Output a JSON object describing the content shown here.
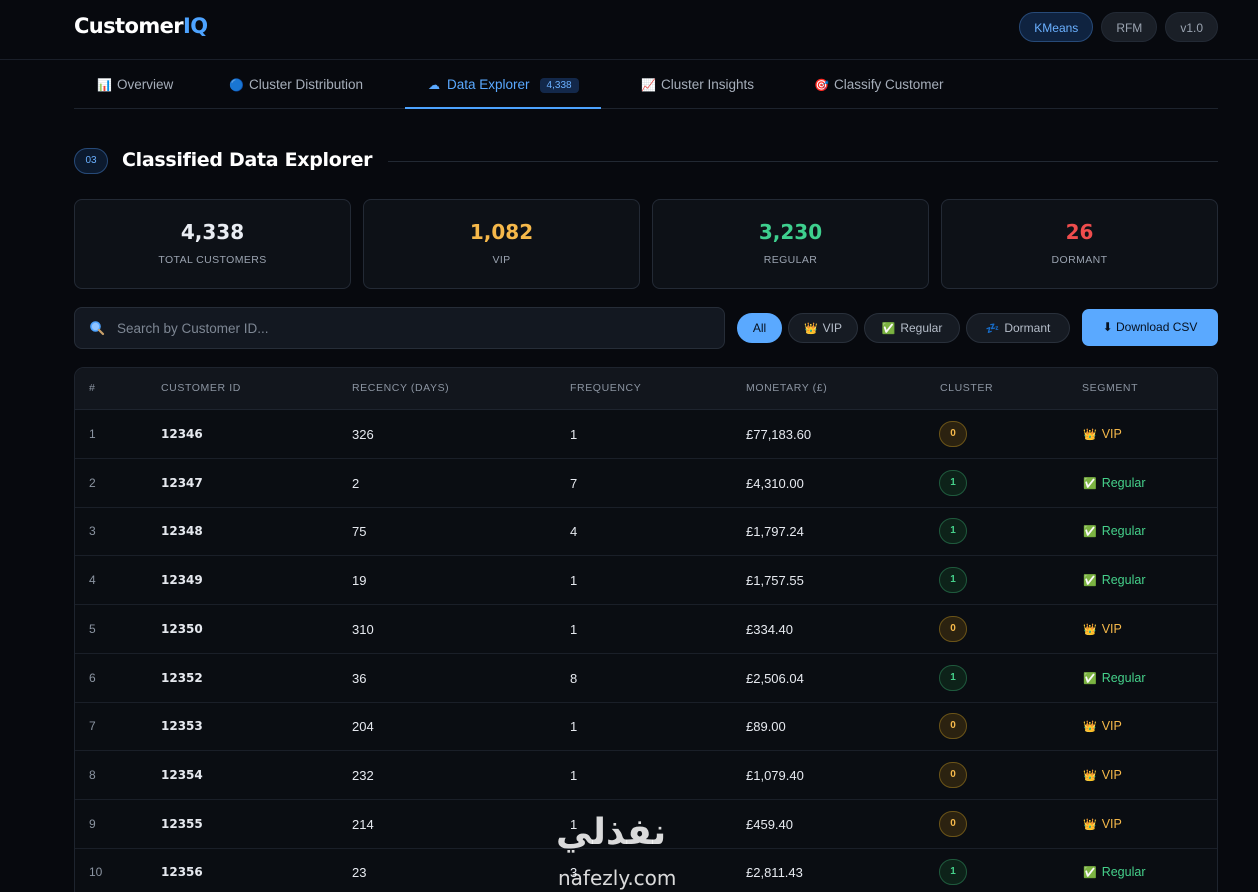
{
  "app": {
    "logo_main": "Customer",
    "logo_accent": "IQ"
  },
  "header_pills": [
    "KMeans",
    "RFM",
    "v1.0"
  ],
  "tabs": [
    {
      "icon": "📊",
      "label": "Overview"
    },
    {
      "icon": "🔵",
      "label": "Cluster Distribution"
    },
    {
      "icon": "☁",
      "label": "Data Explorer",
      "badge": "4,338"
    },
    {
      "icon": "📈",
      "label": "Cluster Insights"
    },
    {
      "icon": "🎯",
      "label": "Classify Customer"
    }
  ],
  "section": {
    "number": "03",
    "title": "Classified Data Explorer"
  },
  "stats": [
    {
      "value": "4,338",
      "label": "TOTAL CUSTOMERS",
      "color": "#e9edf3"
    },
    {
      "value": "1,082",
      "label": "VIP",
      "color": "#f5b84a"
    },
    {
      "value": "3,230",
      "label": "REGULAR",
      "color": "#3ecf8e"
    },
    {
      "value": "26",
      "label": "DORMANT",
      "color": "#ef4d4d"
    }
  ],
  "search": {
    "placeholder": "Search by Customer ID...",
    "value": ""
  },
  "filters": [
    {
      "icon": "",
      "label": "All"
    },
    {
      "icon": "👑",
      "label": "VIP"
    },
    {
      "icon": "✅",
      "label": "Regular"
    },
    {
      "icon": "💤",
      "label": "Dormant"
    }
  ],
  "download_label": "⬇ Download CSV",
  "table": {
    "columns": [
      "#",
      "CUSTOMER ID",
      "RECENCY (DAYS)",
      "FREQUENCY",
      "MONETARY (£)",
      "CLUSTER",
      "SEGMENT"
    ],
    "rows": [
      {
        "idx": "1",
        "id": "12346",
        "recency": "326",
        "frequency": "1",
        "monetary": "£77,183.60",
        "cluster": "0",
        "segment": "VIP"
      },
      {
        "idx": "2",
        "id": "12347",
        "recency": "2",
        "frequency": "7",
        "monetary": "£4,310.00",
        "cluster": "1",
        "segment": "Regular"
      },
      {
        "idx": "3",
        "id": "12348",
        "recency": "75",
        "frequency": "4",
        "monetary": "£1,797.24",
        "cluster": "1",
        "segment": "Regular"
      },
      {
        "idx": "4",
        "id": "12349",
        "recency": "19",
        "frequency": "1",
        "monetary": "£1,757.55",
        "cluster": "1",
        "segment": "Regular"
      },
      {
        "idx": "5",
        "id": "12350",
        "recency": "310",
        "frequency": "1",
        "monetary": "£334.40",
        "cluster": "0",
        "segment": "VIP"
      },
      {
        "idx": "6",
        "id": "12352",
        "recency": "36",
        "frequency": "8",
        "monetary": "£2,506.04",
        "cluster": "1",
        "segment": "Regular"
      },
      {
        "idx": "7",
        "id": "12353",
        "recency": "204",
        "frequency": "1",
        "monetary": "£89.00",
        "cluster": "0",
        "segment": "VIP"
      },
      {
        "idx": "8",
        "id": "12354",
        "recency": "232",
        "frequency": "1",
        "monetary": "£1,079.40",
        "cluster": "0",
        "segment": "VIP"
      },
      {
        "idx": "9",
        "id": "12355",
        "recency": "214",
        "frequency": "1",
        "monetary": "£459.40",
        "cluster": "0",
        "segment": "VIP"
      },
      {
        "idx": "10",
        "id": "12356",
        "recency": "23",
        "frequency": "3",
        "monetary": "£2,811.43",
        "cluster": "1",
        "segment": "Regular"
      }
    ]
  },
  "segment_icons": {
    "VIP": "👑",
    "Regular": "✅"
  },
  "watermark": {
    "arabic": "نفذلي",
    "latin": "nafezly.com"
  }
}
